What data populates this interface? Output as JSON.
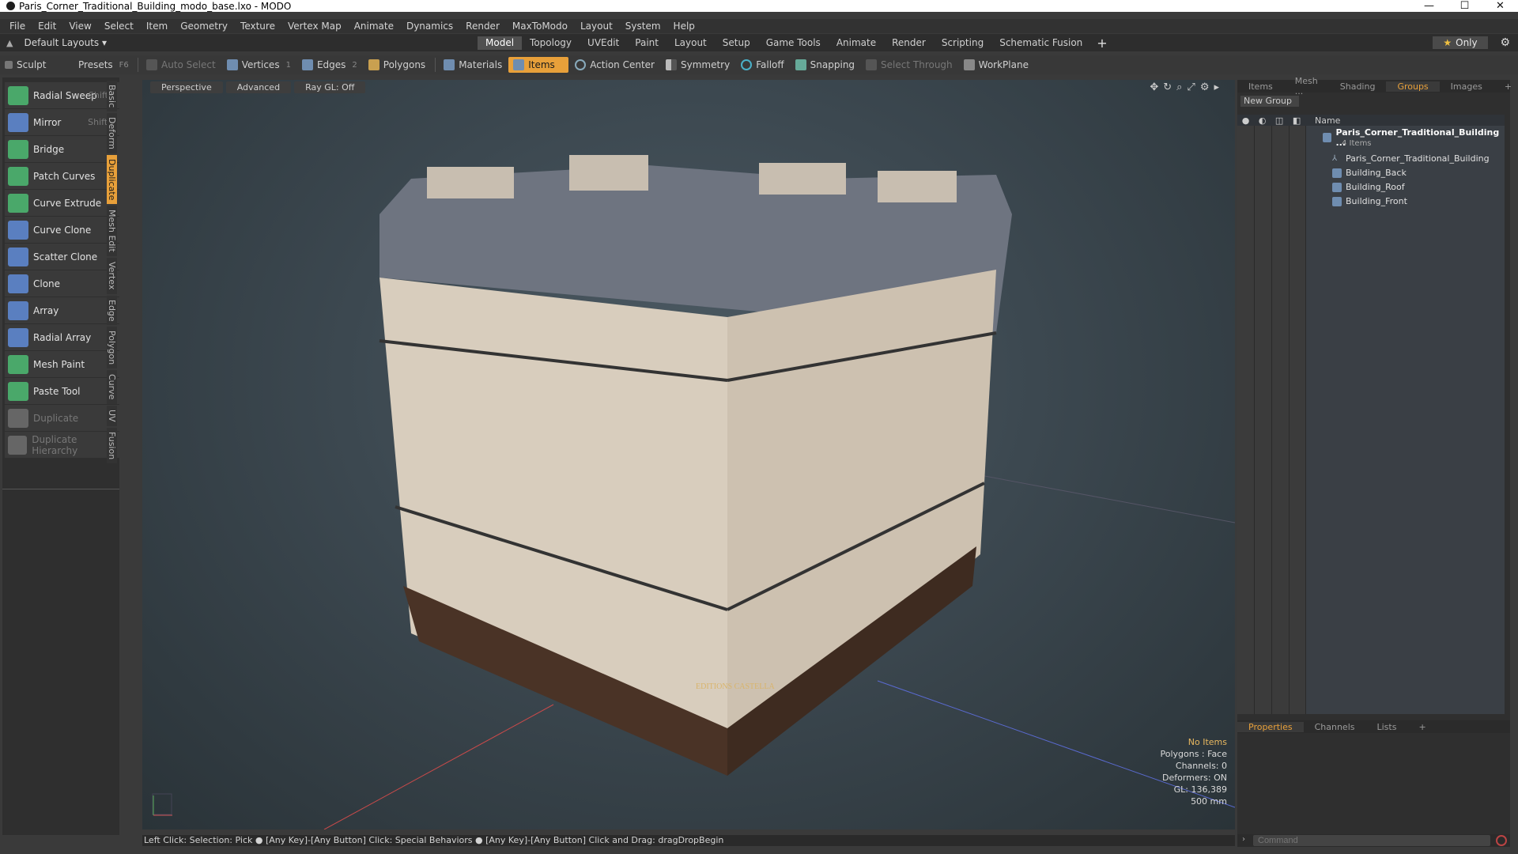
{
  "window": {
    "title": "Paris_Corner_Traditional_Building_modo_base.lxo - MODO",
    "minimize": "—",
    "maximize": "☐",
    "close": "✕"
  },
  "menu": [
    "File",
    "Edit",
    "View",
    "Select",
    "Item",
    "Geometry",
    "Texture",
    "Vertex Map",
    "Animate",
    "Dynamics",
    "Render",
    "MaxToModo",
    "Layout",
    "System",
    "Help"
  ],
  "layout": {
    "selector": "Default Layouts ▾",
    "tabs": [
      "Model",
      "Topology",
      "UVEdit",
      "Paint",
      "Layout",
      "Setup",
      "Game Tools",
      "Animate",
      "Render",
      "Scripting",
      "Schematic Fusion"
    ],
    "active_tab": "Model",
    "only_label": "Only"
  },
  "toolbar": {
    "sculpt": "Sculpt",
    "presets": "Presets",
    "presets_key": "F6",
    "auto_select": "Auto Select",
    "vertices": "Vertices",
    "vertices_count": "1",
    "edges": "Edges",
    "edges_count": "2",
    "polygons": "Polygons",
    "materials": "Materials",
    "items": "Items",
    "action_center": "Action Center",
    "symmetry": "Symmetry",
    "falloff": "Falloff",
    "snapping": "Snapping",
    "select_through": "Select Through",
    "workplane": "WorkPlane"
  },
  "tools": [
    {
      "label": "Radial Sweep",
      "shortcut": "Shift-L",
      "icon": "radial-sweep-icon",
      "color": "#4aa86a"
    },
    {
      "label": "Mirror",
      "shortcut": "Shift-V",
      "icon": "mirror-icon",
      "color": "#5a7fc0"
    },
    {
      "label": "Bridge",
      "shortcut": "",
      "icon": "bridge-icon",
      "color": "#4aa86a"
    },
    {
      "label": "Patch Curves",
      "shortcut": "",
      "icon": "patch-curves-icon",
      "color": "#4aa86a"
    },
    {
      "label": "Curve Extrude",
      "shortcut": "",
      "icon": "curve-extrude-icon",
      "color": "#4aa86a"
    },
    {
      "label": "Curve Clone",
      "shortcut": "",
      "icon": "curve-clone-icon",
      "color": "#5a7fc0"
    },
    {
      "label": "Scatter Clone",
      "shortcut": "",
      "icon": "scatter-clone-icon",
      "color": "#5a7fc0"
    },
    {
      "label": "Clone",
      "shortcut": "",
      "icon": "clone-icon",
      "color": "#5a7fc0"
    },
    {
      "label": "Array",
      "shortcut": "",
      "icon": "array-icon",
      "color": "#5a7fc0"
    },
    {
      "label": "Radial Array",
      "shortcut": "",
      "icon": "radial-array-icon",
      "color": "#5a7fc0"
    },
    {
      "label": "Mesh Paint",
      "shortcut": "",
      "icon": "mesh-paint-icon",
      "color": "#4aa86a"
    },
    {
      "label": "Paste Tool",
      "shortcut": "",
      "icon": "paste-tool-icon",
      "color": "#4aa86a"
    },
    {
      "label": "Duplicate",
      "shortcut": "",
      "icon": "duplicate-icon",
      "color": "#666666"
    },
    {
      "label": "Duplicate Hierarchy",
      "shortcut": "",
      "icon": "duplicate-hierarchy-icon",
      "color": "#666666"
    }
  ],
  "vertical_tabs": [
    "Basic",
    "Deform",
    "Duplicate",
    "Mesh Edit",
    "Vertex",
    "Edge",
    "Polygon",
    "Curve",
    "UV",
    "Fusion"
  ],
  "active_vertical_tab": "Duplicate",
  "viewport": {
    "view": "Perspective",
    "mode": "Advanced",
    "raygl": "Ray GL: Off",
    "sign": "EDITIONS CASTELLA",
    "hud": {
      "selection": "No Items",
      "polygons": "Polygons : Face",
      "channels": "Channels: 0",
      "deformers": "Deformers: ON",
      "gl": "GL: 136,389",
      "scale": "500 mm"
    }
  },
  "right_panel": {
    "tabs": [
      "Items",
      "Mesh ...",
      "Shading",
      "Groups",
      "Images"
    ],
    "active_tab": "Groups",
    "new_group": "New Group",
    "column_name": "Name",
    "tree": {
      "root": "Paris_Corner_Traditional_Building ...",
      "root_sub": "4 Items",
      "children": [
        "Paris_Corner_Traditional_Building",
        "Building_Back",
        "Building_Roof",
        "Building_Front"
      ]
    },
    "bottom_tabs": [
      "Properties",
      "Channels",
      "Lists"
    ],
    "bottom_active": "Properties"
  },
  "status": {
    "hint": "Left Click: Selection: Pick ● [Any Key]-[Any Button] Click: Special Behaviors ● [Any Key]-[Any Button] Click and Drag: dragDropBegin",
    "command_placeholder": "Command"
  }
}
